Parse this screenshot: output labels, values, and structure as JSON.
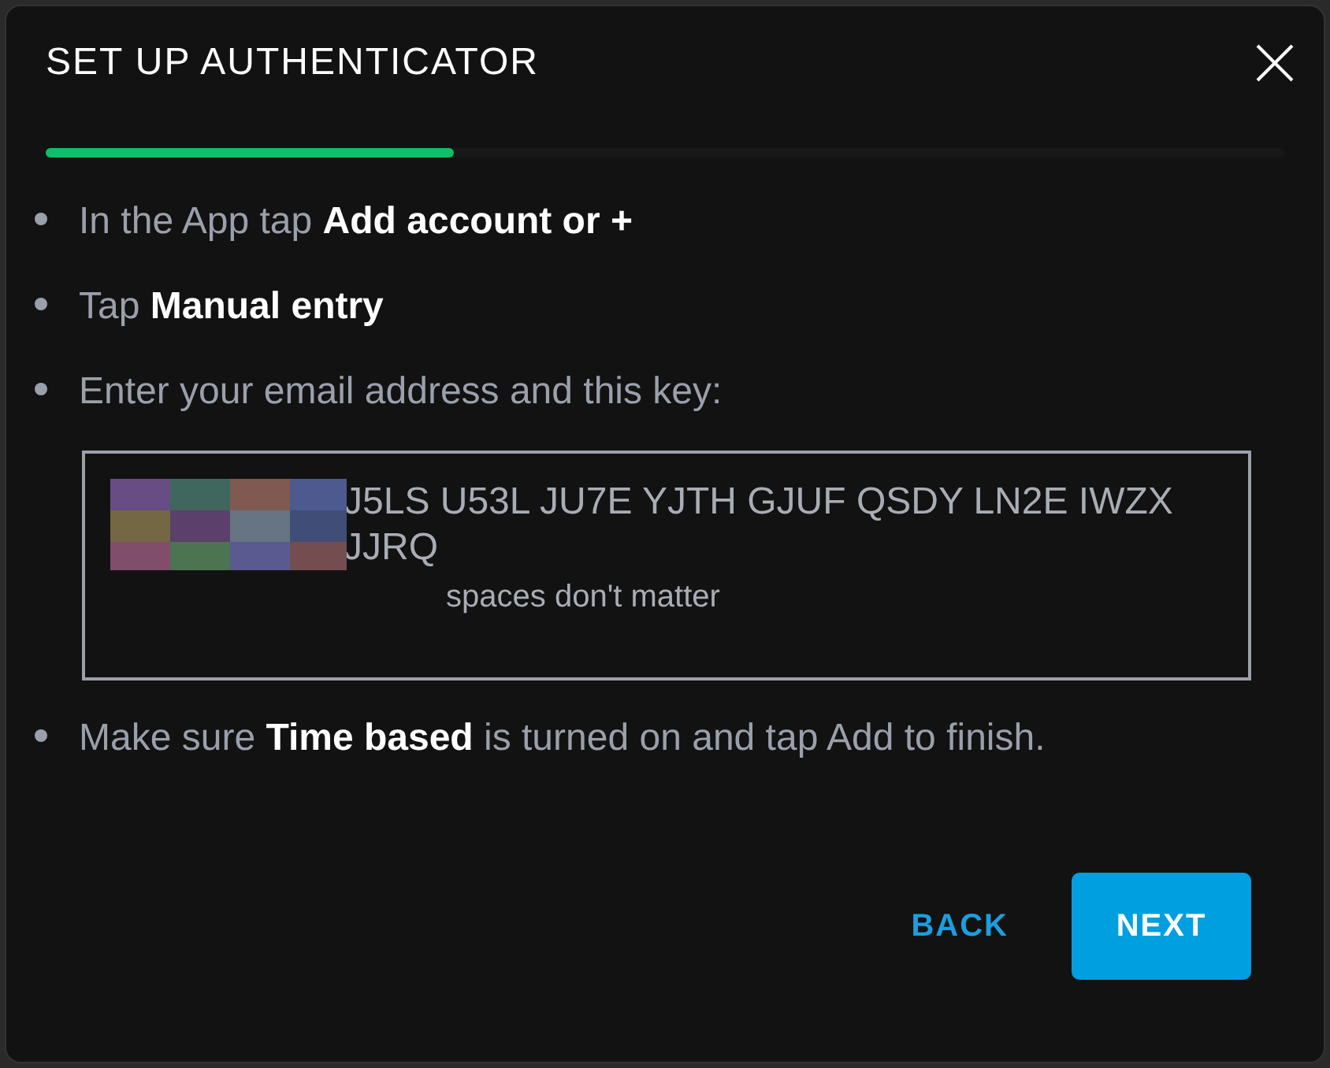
{
  "dialog": {
    "title": "SET UP AUTHENTICATOR"
  },
  "progress": {
    "level": 0.33
  },
  "steps": [
    {
      "kind": "text",
      "text": "In the App tap **Add account or +**"
    },
    {
      "kind": "text",
      "text": "Tap **Manual entry**"
    },
    {
      "kind": "text",
      "text": "Enter your email address and this key:"
    },
    {
      "kind": "key",
      "key": "J5LS U53L JU7E YJTH GJUF QSDY LN2E IWZX JJRQ",
      "hint": "spaces don't matter"
    },
    {
      "kind": "text",
      "text": "Make sure **Time based** is turned on and tap Add to finish."
    }
  ],
  "buttons": [
    {
      "label": "BACK",
      "kind": "text"
    },
    {
      "label": "NEXT",
      "kind": "primary"
    }
  ]
}
